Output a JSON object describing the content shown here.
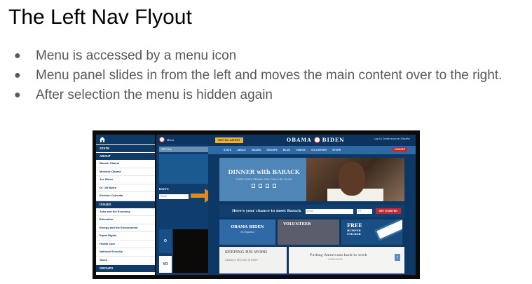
{
  "slide": {
    "title": "The Left Nav Flyout",
    "bullets": [
      "Menu is accessed by a menu icon",
      "Menu panel slides in from the left and moves the main content over to the right.",
      "After selection the menu is hidden again"
    ]
  },
  "mobile": {
    "menu_label": "Menu",
    "get_label": "GET the",
    "sections": [
      {
        "header": "STATE",
        "items": []
      },
      {
        "header": "ABOUT",
        "items": [
          "Barack Obama",
          "Michelle Obama",
          "Joe Biden",
          "Dr. Jill Biden",
          "Election Calendar"
        ]
      },
      {
        "header": "ISSUES",
        "items": [
          "Jobs and the Economy",
          "Education",
          "Energy and the Environment",
          "Equal Rights",
          "Health Care",
          "National Security",
          "Taxes"
        ]
      },
      {
        "header": "GROUPS",
        "items": []
      }
    ],
    "here_text": "Here's",
    "email_placeholder": "Email",
    "panel_o": "O",
    "panel_vo": "VO"
  },
  "site": {
    "get_latest": "GET the LATEST",
    "brand_left": "OBAMA",
    "brand_right": "BIDEN",
    "top_links": "Log in  |  Create account  |  Español",
    "nav": [
      "STATE",
      "ABOUT",
      "ISSUES",
      "GROUPS",
      "BLOG",
      "VIDEOS",
      "VOLUNTEER",
      "STORE"
    ],
    "donate": "DONATE",
    "hero_title": "DINNER with BARACK",
    "hero_sub": "THREE SEATS REMAIN: ONE COULD BE YOURS",
    "signup_label": "Here's your chance to meet Barack",
    "email_placeholder": "Email",
    "zip_placeholder": "ZIP",
    "get_started": "GET STARTED",
    "tile1_title": "OBAMA BIDEN",
    "tile1_sub": "en Español",
    "tile2": "VOLUNTEER",
    "tile3_title": "FREE",
    "tile3_l1": "BUMPER",
    "tile3_l2": "STICKER",
    "b1_title": "KEEPING HIS WORD",
    "b1_sub": "OBAMA'S RECORD IN BRIEF",
    "b2_title": "Putting Americans back to work",
    "b2_sub": "LEARN MORE"
  },
  "colors": {
    "arrow": "#e08a1e",
    "navy": "#0d3866",
    "red": "#c8282a"
  }
}
